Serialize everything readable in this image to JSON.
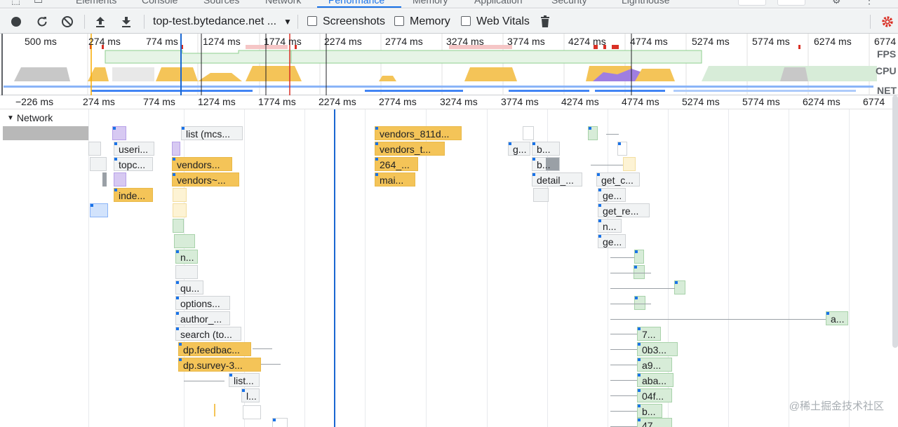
{
  "tabs": [
    {
      "label": "Elements"
    },
    {
      "label": "Console"
    },
    {
      "label": "Sources"
    },
    {
      "label": "Network"
    },
    {
      "label": "Performance",
      "active": true
    },
    {
      "label": "Memory"
    },
    {
      "label": "Application"
    },
    {
      "label": "Security"
    },
    {
      "label": "Lighthouse"
    }
  ],
  "toolbar": {
    "profile_select": "top-test.bytedance.net ...",
    "screenshots_label": "Screenshots",
    "memory_label": "Memory",
    "web_vitals_label": "Web Vitals",
    "screenshots_checked": false,
    "memory_checked": false,
    "web_vitals_checked": false
  },
  "overview": {
    "ticks": [
      "500 ms",
      "274 ms",
      "774 ms",
      "1274 ms",
      "1774 ms",
      "2274 ms",
      "2774 ms",
      "3274 ms",
      "3774 ms",
      "4274 ms",
      "4774 ms",
      "5274 ms",
      "5774 ms",
      "6274 ms",
      "6774"
    ],
    "labels": {
      "fps": "FPS",
      "cpu": "CPU",
      "net": "NET"
    }
  },
  "ruler": {
    "ticks": [
      "−226 ms",
      "274 ms",
      "774 ms",
      "1274 ms",
      "1774 ms",
      "2274 ms",
      "2774 ms",
      "3274 ms",
      "3774 ms",
      "4274 ms",
      "4774 ms",
      "5274 ms",
      "5774 ms",
      "6274 ms",
      "6774"
    ]
  },
  "network": {
    "header": "Network",
    "requests": [
      {
        "label": "list (mcs...",
        "color": "gray"
      },
      {
        "label": "useri...",
        "color": "gray"
      },
      {
        "label": "topc...",
        "color": "gray"
      },
      {
        "label": "vendors...",
        "color": "yellow"
      },
      {
        "label": "vendors~...",
        "color": "yellow"
      },
      {
        "label": "inde...",
        "color": "yellow"
      },
      {
        "label": "vendors_811d...",
        "color": "yellow"
      },
      {
        "label": "vendors_t...",
        "color": "yellow"
      },
      {
        "label": "264_...",
        "color": "yellow"
      },
      {
        "label": "mai...",
        "color": "yellow"
      },
      {
        "label": "g...",
        "color": "gray"
      },
      {
        "label": "b...",
        "color": "gray"
      },
      {
        "label": "b...",
        "color": "gray"
      },
      {
        "label": "detail_...",
        "color": "gray"
      },
      {
        "label": "get_c...",
        "color": "gray"
      },
      {
        "label": "ge...",
        "color": "gray"
      },
      {
        "label": "get_re...",
        "color": "gray"
      },
      {
        "label": "n...",
        "color": "gray"
      },
      {
        "label": "ge...",
        "color": "gray"
      },
      {
        "label": "n...",
        "color": "green"
      },
      {
        "label": "qu...",
        "color": "gray"
      },
      {
        "label": "options...",
        "color": "gray"
      },
      {
        "label": "author_...",
        "color": "gray"
      },
      {
        "label": "search (to...",
        "color": "gray"
      },
      {
        "label": "dp.feedbac...",
        "color": "yellow"
      },
      {
        "label": "dp.survey-3...",
        "color": "yellow"
      },
      {
        "label": "list...",
        "color": "gray"
      },
      {
        "label": "l...",
        "color": "gray"
      },
      {
        "label": "a...",
        "color": "green"
      },
      {
        "label": "7...",
        "color": "green"
      },
      {
        "label": "0b3...",
        "color": "green"
      },
      {
        "label": "a9...",
        "color": "green"
      },
      {
        "label": "aba...",
        "color": "green"
      },
      {
        "label": "04f...",
        "color": "green"
      },
      {
        "label": "b...",
        "color": "green"
      },
      {
        "label": "47",
        "color": "green"
      }
    ]
  },
  "watermark": "@稀土掘金技术社区"
}
